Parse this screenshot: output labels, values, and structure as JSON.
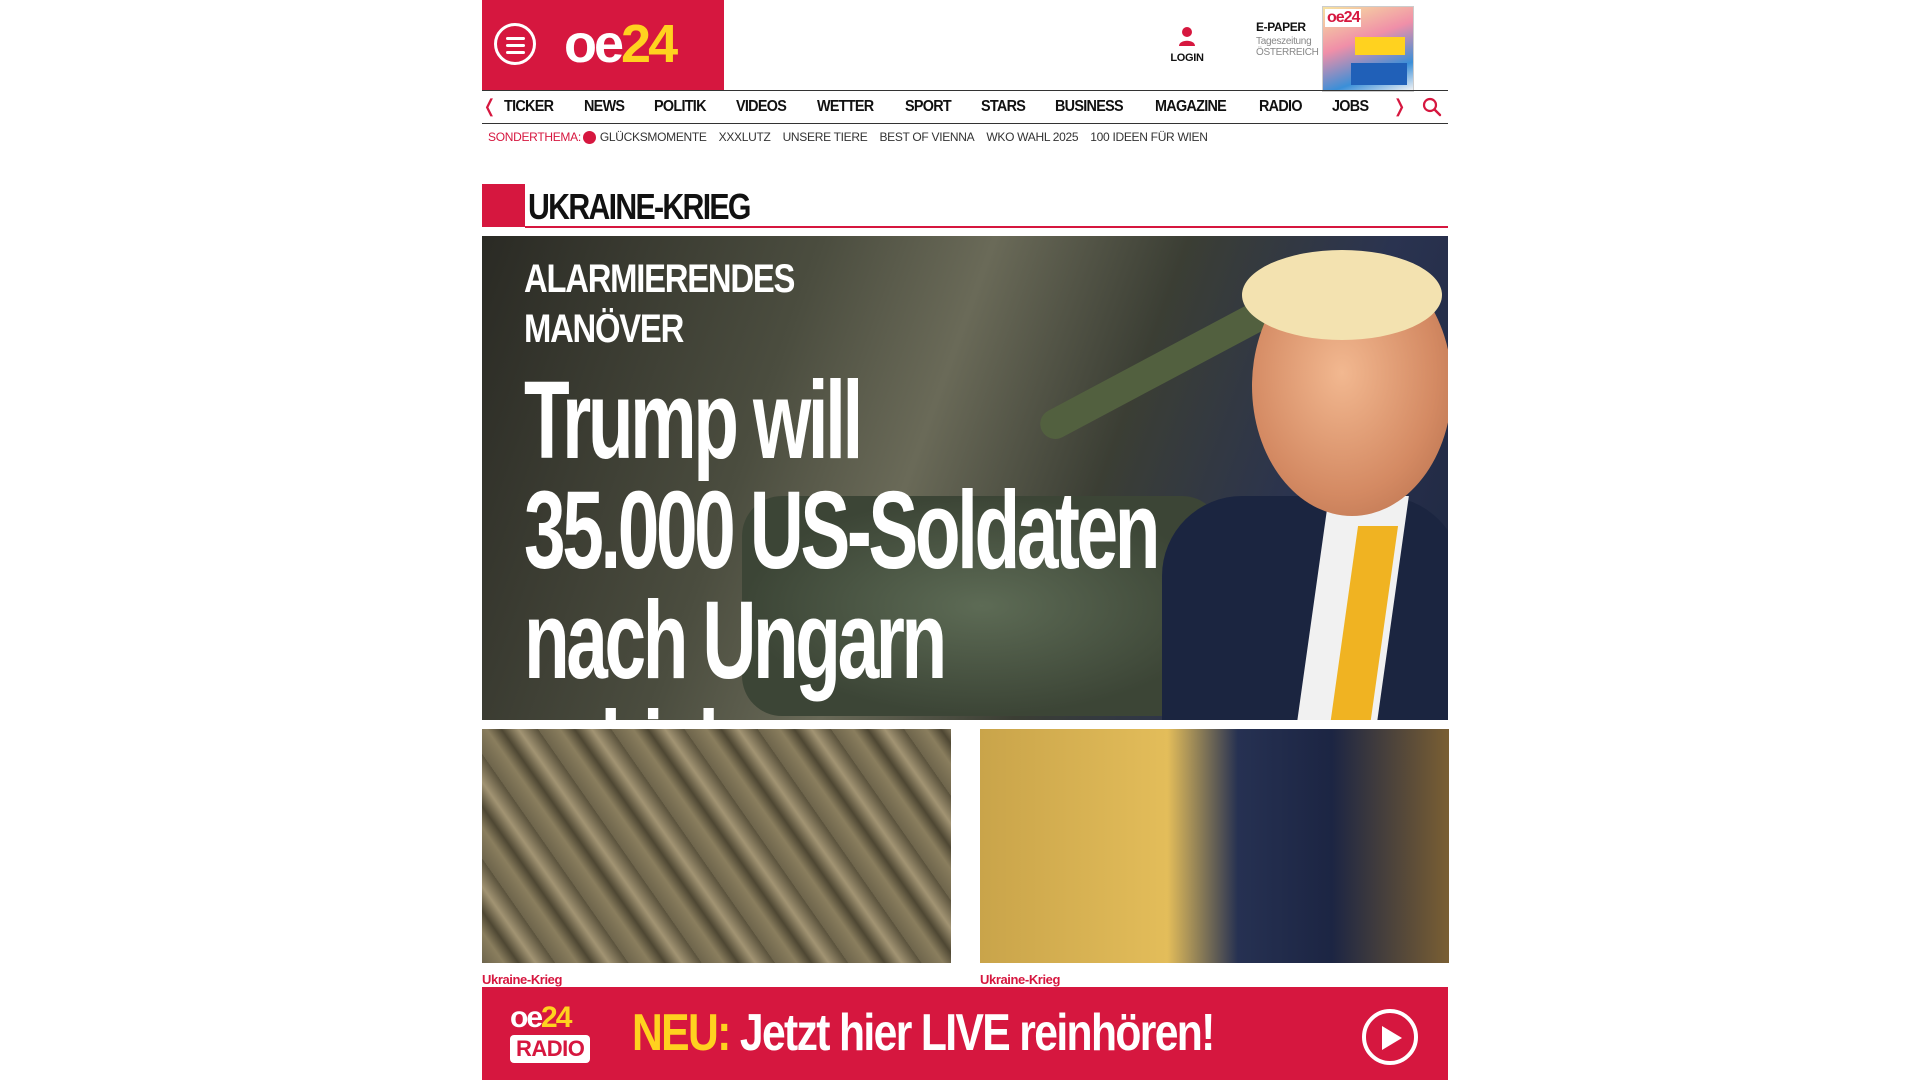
{
  "header": {
    "logo_oe": "oe",
    "logo_24": "24",
    "login_label": "LOGIN",
    "epaper_title": "E-PAPER",
    "epaper_sub1": "Tageszeitung",
    "epaper_sub2": "ÖSTERREICH",
    "epaper_cover_mast": "oe24"
  },
  "nav": {
    "items": [
      "TICKER",
      "NEWS",
      "POLITIK",
      "VIDEOS",
      "WETTER",
      "SPORT",
      "STARS",
      "BUSINESS",
      "MAGAZINE",
      "RADIO",
      "JOBS"
    ]
  },
  "subnav": {
    "label": "SONDERTHEMA:",
    "items": [
      "GLÜCKSMOMENTE",
      "XXXLUTZ",
      "UNSERE TIERE",
      "BEST OF VIENNA",
      "WKO WAHL 2025",
      "100 IDEEN FÜR WIEN"
    ]
  },
  "section": {
    "title": "UKRAINE-KRIEG"
  },
  "hero": {
    "kicker_line1": "ALARMIERENDES",
    "kicker_line2": "MANÖVER",
    "title_line1": "Trump will",
    "title_line2": "35.000 US-Soldaten",
    "title_line3": "nach Ungarn schicken"
  },
  "teasers": [
    {
      "category": "Ukraine-Krieg"
    },
    {
      "category": "Ukraine-Krieg"
    }
  ],
  "radio_banner": {
    "logo_oe": "oe",
    "logo_24": "24",
    "logo_radio": "RADIO",
    "highlight": "NEU:",
    "text": " Jetzt hier LIVE reinhören!"
  },
  "colors": {
    "brand_red": "#d6173f",
    "brand_yellow": "#ffd21f"
  }
}
